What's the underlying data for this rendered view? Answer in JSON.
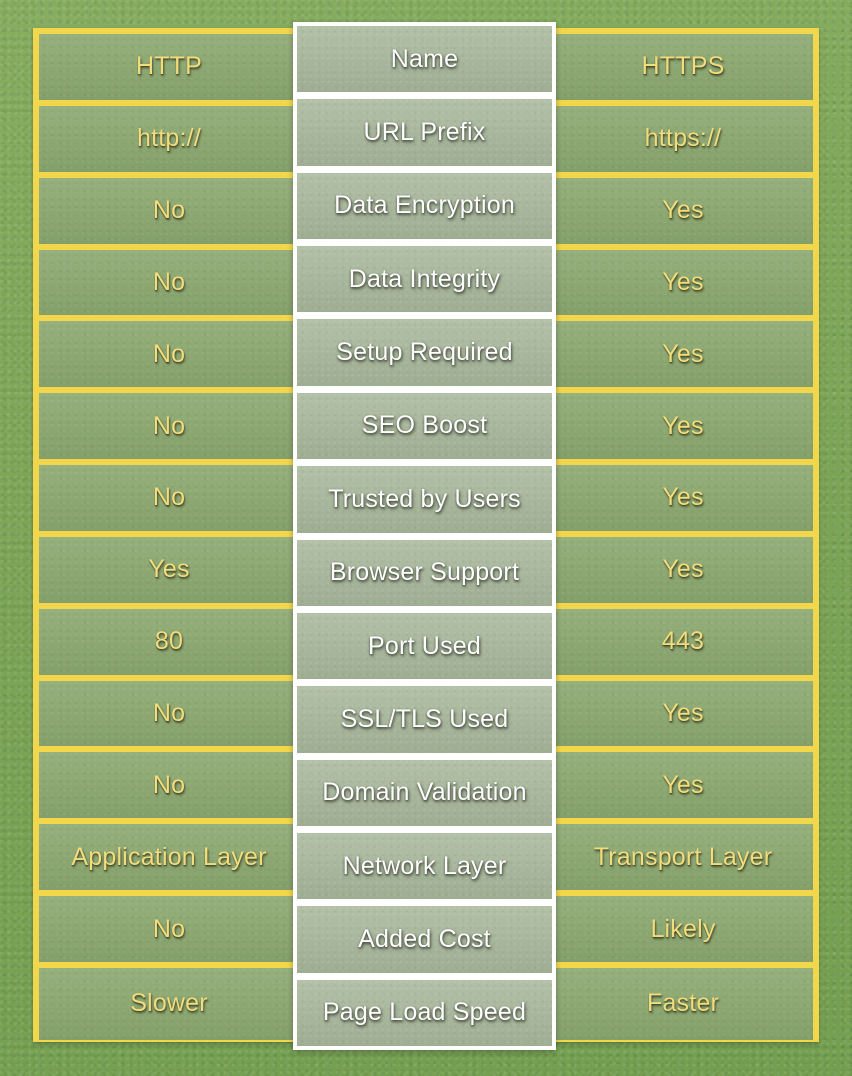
{
  "infographic": {
    "title": "HTTP vs HTTPS comparison table",
    "columns": {
      "left_header": "HTTP",
      "center_header": "Name",
      "right_header": "HTTPS"
    },
    "colors": {
      "background_green": "#7ba456",
      "row_green": "#8ba86f",
      "center_cell_green": "#a7b79a",
      "border_yellow": "#f2d64c",
      "side_text_yellow": "#f2dd7c",
      "center_text_white": "#ffffff"
    }
  },
  "chart_data": {
    "type": "table",
    "title": "HTTP vs HTTPS comparison table",
    "columns": [
      "HTTP",
      "Name",
      "HTTPS"
    ],
    "rows": [
      {
        "left": "HTTP",
        "center": "Name",
        "right": "HTTPS"
      },
      {
        "left": "http://",
        "center": "URL Prefix",
        "right": "https://"
      },
      {
        "left": "No",
        "center": "Data Encryption",
        "right": "Yes"
      },
      {
        "left": "No",
        "center": "Data Integrity",
        "right": "Yes"
      },
      {
        "left": "No",
        "center": "Setup Required",
        "right": "Yes"
      },
      {
        "left": "No",
        "center": "SEO Boost",
        "right": "Yes"
      },
      {
        "left": "No",
        "center": "Trusted by Users",
        "right": "Yes"
      },
      {
        "left": "Yes",
        "center": "Browser Support",
        "right": "Yes"
      },
      {
        "left": "80",
        "center": "Port Used",
        "right": "443"
      },
      {
        "left": "No",
        "center": "SSL/TLS Used",
        "right": "Yes"
      },
      {
        "left": "No",
        "center": "Domain Validation",
        "right": "Yes"
      },
      {
        "left": "Application Layer",
        "center": "Network Layer",
        "right": "Transport Layer"
      },
      {
        "left": "No",
        "center": "Added Cost",
        "right": "Likely"
      },
      {
        "left": "Slower",
        "center": "Page Load Speed",
        "right": "Faster"
      }
    ]
  }
}
